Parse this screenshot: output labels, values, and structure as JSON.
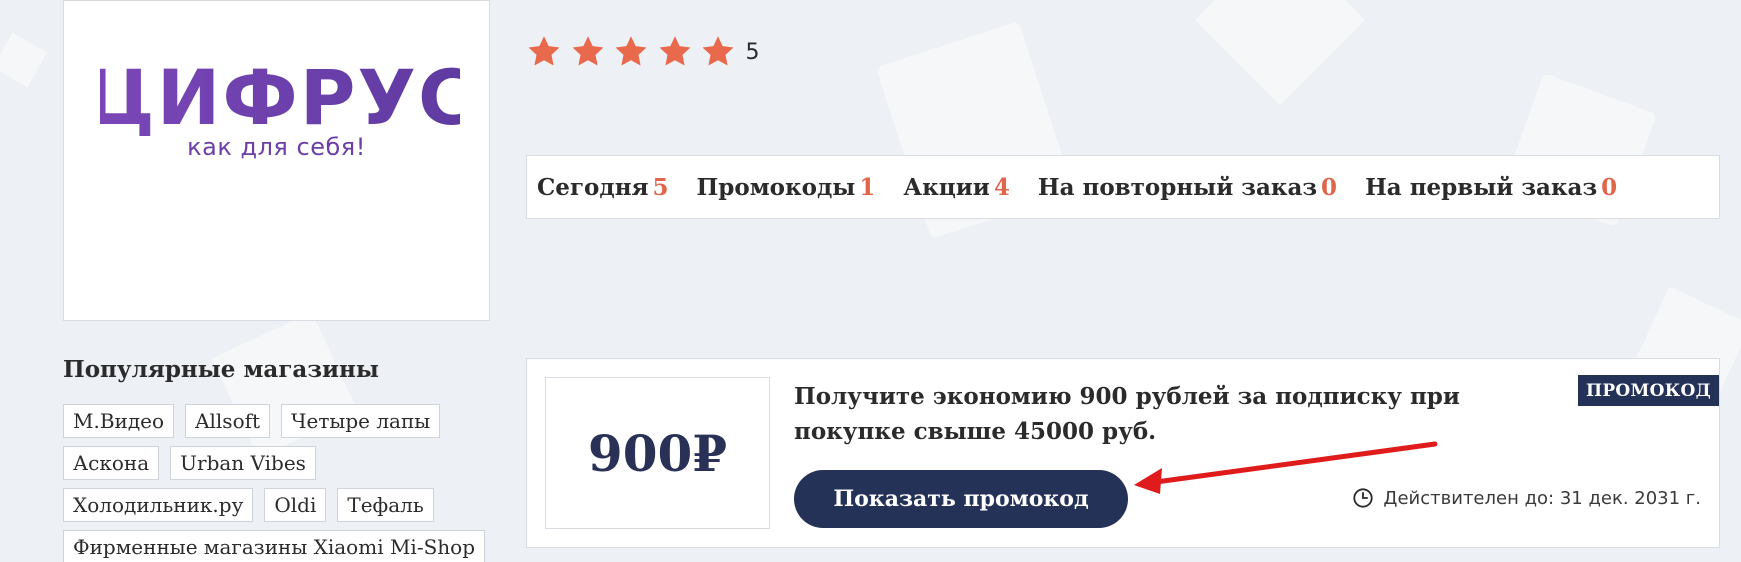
{
  "store": {
    "logo_text": "ЦИФРУС",
    "logo_tagline": "как для себя!",
    "rating": {
      "stars_filled": 5,
      "stars_total": 5,
      "value": "5"
    }
  },
  "tabs": [
    {
      "label": "Сегодня",
      "count": "5"
    },
    {
      "label": "Промокоды",
      "count": "1"
    },
    {
      "label": "Акции",
      "count": "4"
    },
    {
      "label": "На повторный заказ",
      "count": "0"
    },
    {
      "label": "На первый заказ",
      "count": "0"
    }
  ],
  "popular_shops": {
    "title": "Популярные магазины",
    "rows": [
      [
        "М.Видео",
        "Allsoft",
        "Четыре лапы"
      ],
      [
        "Аскона",
        "Urban Vibes"
      ],
      [
        "Холодильник.ру",
        "Oldi",
        "Тефаль"
      ],
      [
        "Фирменные магазины Xiaomi Mi-Shop"
      ]
    ]
  },
  "coupon": {
    "value": "900₽",
    "title": "Получите экономию 900 рублей за подписку при покупке свыше 45000 руб.",
    "badge": "ПРОМОКОД",
    "button_label": "Показать промокод",
    "validity": "Действителен до: 31 дек. 2031 г."
  },
  "colors": {
    "accent_orange": "#e0654a",
    "navy": "#253258",
    "logo_purple": "#6b3fa6",
    "annotation_red": "#e01b1b"
  },
  "icons": [
    "star-icon",
    "clock-icon",
    "annotation-arrow-icon"
  ]
}
